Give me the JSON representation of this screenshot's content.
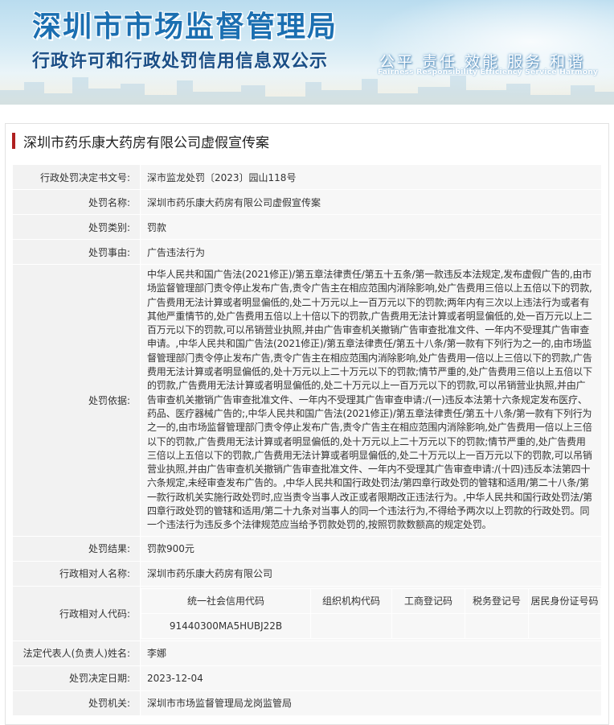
{
  "header": {
    "title": "深圳市市场监督管理局",
    "subtitle": "行政许可和行政处罚信用信息双公示",
    "slogan": "公平  责任  效能  服务  和谐",
    "slogan_en": "Fairness  Responsibility  Efficiency  Service  Harmony"
  },
  "case": {
    "title": "深圳市药乐康大药房有限公司虚假宣传案"
  },
  "fields": {
    "decision_no_label": "行政处罚决定书文号:",
    "decision_no": "深市监龙处罚〔2023〕园山118号",
    "name_label": "处罚名称:",
    "name": "深圳市药乐康大药房有限公司虚假宣传案",
    "type_label": "处罚类别:",
    "type": "罚款",
    "reason_label": "处罚事由:",
    "reason": "广告违法行为",
    "basis_label": "处罚依据:",
    "basis": "中华人民共和国广告法(2021修正)/第五章法律责任/第五十五条/第一款违反本法规定,发布虚假广告的,由市场监督管理部门责令停止发布广告,责令广告主在相应范围内消除影响,处广告费用三倍以上五倍以下的罚款,广告费用无法计算或者明显偏低的,处二十万元以上一百万元以下的罚款;两年内有三次以上违法行为或者有其他严重情节的,处广告费用五倍以上十倍以下的罚款,广告费用无法计算或者明显偏低的,处一百万元以上二百万元以下的罚款,可以吊销营业执照,并由广告审查机关撤销广告审查批准文件、一年内不受理其广告审查申请。,中华人民共和国广告法(2021修正)/第五章法律责任/第五十八条/第一款有下列行为之一的,由市场监督管理部门责令停止发布广告,责令广告主在相应范围内消除影响,处广告费用一倍以上三倍以下的罚款,广告费用无法计算或者明显偏低的,处十万元以上二十万元以下的罚款;情节严重的,处广告费用三倍以上五倍以下的罚款,广告费用无法计算或者明显偏低的,处二十万元以上一百万元以下的罚款,可以吊销营业执照,并由广告审查机关撤销广告审查批准文件、一年内不受理其广告审查申请:/(一)违反本法第十六条规定发布医疗、药品、医疗器械广告的;,中华人民共和国广告法(2021修正)/第五章法律责任/第五十八条/第一款有下列行为之一的,由市场监督管理部门责令停止发布广告,责令广告主在相应范围内消除影响,处广告费用一倍以上三倍以下的罚款,广告费用无法计算或者明显偏低的,处十万元以上二十万元以下的罚款;情节严重的,处广告费用三倍以上五倍以下的罚款,广告费用无法计算或者明显偏低的,处二十万元以上一百万元以下的罚款,可以吊销营业执照,并由广告审查机关撤销广告审查批准文件、一年内不受理其广告审查申请:/(十四)违反本法第四十六条规定,未经审查发布广告的。,中华人民共和国行政处罚法/第四章行政处罚的管辖和适用/第二十八条/第一款行政机关实施行政处罚时,应当责令当事人改正或者限期改正违法行为。,中华人民共和国行政处罚法/第四章行政处罚的管辖和适用/第二十九条对当事人的同一个违法行为,不得给予两次以上罚款的行政处罚。同一个违法行为违反多个法律规范应当给予罚款处罚的,按照罚款数额高的规定处罚。",
    "result_label": "处罚结果:",
    "result": "罚款900元",
    "party_label": "行政相对人名称:",
    "party": "深圳市药乐康大药房有限公司",
    "code_label": "行政相对人代码:",
    "code_headers": [
      "统一社会信用代码",
      "组织机构代码",
      "工商登记码",
      "税务登记号",
      "居民身份证号码"
    ],
    "code_values": [
      "91440300MA5HUBJ22B",
      "",
      "",
      "",
      ""
    ],
    "rep_label": "法定代表人(负责人)姓名:",
    "rep": "李娜",
    "date_label": "处罚决定日期:",
    "date": "2023-12-04",
    "org_label": "处罚机关:",
    "org": "深圳市市场监督管理局龙岗监管局"
  }
}
